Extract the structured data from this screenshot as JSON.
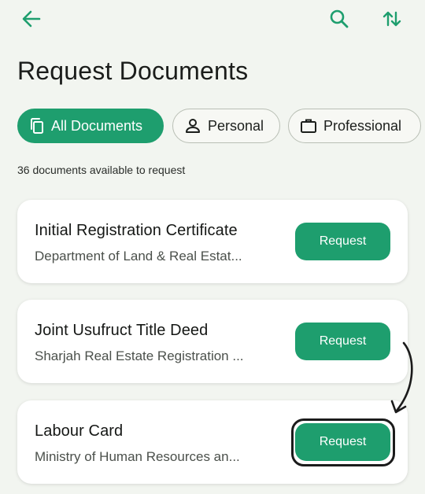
{
  "header": {
    "back_icon": "arrow-left-icon",
    "search_icon": "search-icon",
    "sort_icon": "sort-arrows-icon",
    "accent": "#1e9e6e"
  },
  "page": {
    "title": "Request Documents",
    "count_text": "36 documents available to request"
  },
  "filters": [
    {
      "label": "All Documents",
      "icon": "documents-icon",
      "active": true
    },
    {
      "label": "Personal",
      "icon": "person-icon",
      "active": false
    },
    {
      "label": "Professional",
      "icon": "briefcase-icon",
      "active": false
    }
  ],
  "documents": [
    {
      "title": "Initial Registration Certificate",
      "issuer": "Department of Land & Real Estat...",
      "action": "Request"
    },
    {
      "title": "Joint Usufruct Title Deed",
      "issuer": "Sharjah Real Estate Registration ...",
      "action": "Request"
    },
    {
      "title": "Labour Card",
      "issuer": "Ministry of Human Resources an...",
      "action": "Request"
    }
  ],
  "annotation": {
    "highlighted_item": "Labour Card request button",
    "color": "#1b1b1b"
  }
}
